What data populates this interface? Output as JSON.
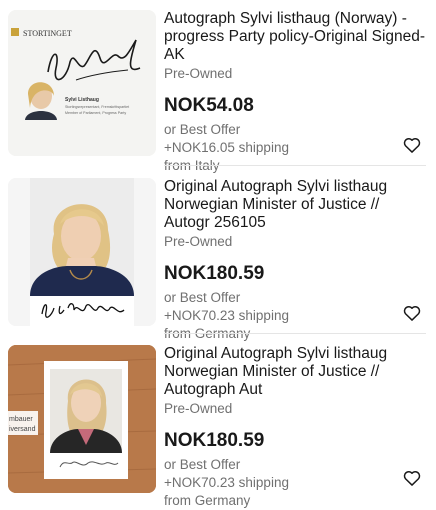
{
  "listings": [
    {
      "title": "Autograph Sylvi listhaug (Norway) - progress Party policy-Original Signed-AK",
      "condition": "Pre-Owned",
      "price": "NOK54.08",
      "offer": "or Best Offer",
      "shipping": "+NOK16.05 shipping",
      "location": "from Italy",
      "image": {
        "header": "STORTINGET",
        "caption_name": "Sylvi Listhaug",
        "caption_line1": "Stortingsrepresentant, Fremskrittspartiet",
        "caption_line2": "Member of Parliament, Progress Party"
      }
    },
    {
      "title": "Original Autograph Sylvi listhaug Norwegian Minister of Justice // Autogr 256105",
      "condition": "Pre-Owned",
      "price": "NOK180.59",
      "offer": "or Best Offer",
      "shipping": "+NOK70.23 shipping",
      "location": "from Germany"
    },
    {
      "title": "Original Autograph Sylvi listhaug Norwegian Minister of Justice // Autograph Aut",
      "condition": "Pre-Owned",
      "price": "NOK180.59",
      "offer": "or Best Offer",
      "shipping": "+NOK70.23 shipping",
      "location": "from Germany",
      "image": {
        "sign_line1": "mbauer",
        "sign_line2": "iversand"
      }
    }
  ],
  "icons": {
    "favorite": "heart-outline-icon"
  },
  "colors": {
    "text": "#191919",
    "secondary": "#707070",
    "divider": "#e5e5e5"
  }
}
